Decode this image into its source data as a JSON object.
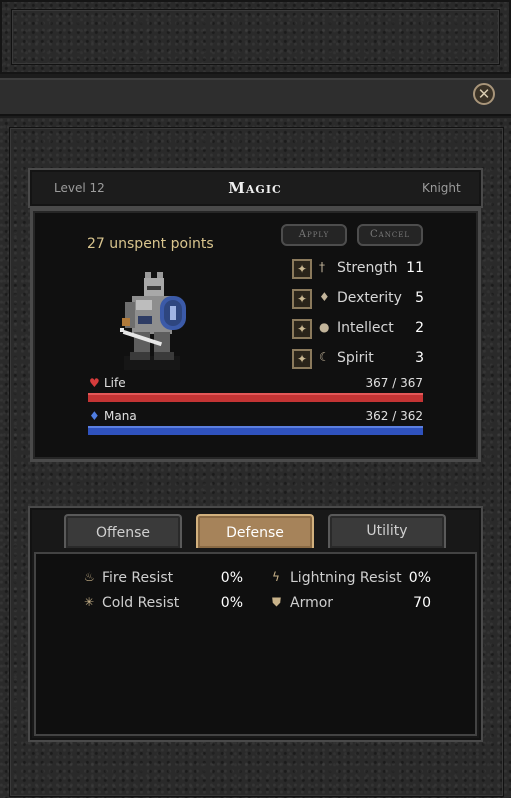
{
  "window": {
    "close_icon": "close-icon"
  },
  "header": {
    "level": "Level 12",
    "title": "Magic",
    "class": "Knight"
  },
  "points": {
    "unspent": "27 unspent points"
  },
  "buttons": {
    "apply": "Apply",
    "cancel": "Cancel"
  },
  "attributes": [
    {
      "name": "Strength",
      "value": "11",
      "icon": "sword-icon"
    },
    {
      "name": "Dexterity",
      "value": "5",
      "icon": "diamond-icon"
    },
    {
      "name": "Intellect",
      "value": "2",
      "icon": "orb-icon"
    },
    {
      "name": "Spirit",
      "value": "3",
      "icon": "moon-icon"
    }
  ],
  "bars": {
    "life": {
      "label": "Life",
      "value": "367 / 367",
      "fraction": 1.0,
      "color": "#c43434",
      "icon": "heart-icon"
    },
    "mana": {
      "label": "Mana",
      "value": "362 / 362",
      "fraction": 1.0,
      "color": "#2f52be",
      "icon": "mana-gem-icon"
    }
  },
  "tabs": [
    {
      "label": "Offense",
      "active": false
    },
    {
      "label": "Defense",
      "active": true
    },
    {
      "label": "Utility",
      "active": false
    }
  ],
  "defense": [
    {
      "label": "Fire Resist",
      "value": "0%",
      "icon": "flame-icon"
    },
    {
      "label": "Lightning Resist",
      "value": "0%",
      "icon": "lightning-icon"
    },
    {
      "label": "Cold Resist",
      "value": "0%",
      "icon": "snowflake-icon"
    },
    {
      "label": "Armor",
      "value": "70",
      "icon": "shield-icon"
    }
  ],
  "colors": {
    "accent": "#a6835a",
    "gold_text": "#d9c58e"
  }
}
